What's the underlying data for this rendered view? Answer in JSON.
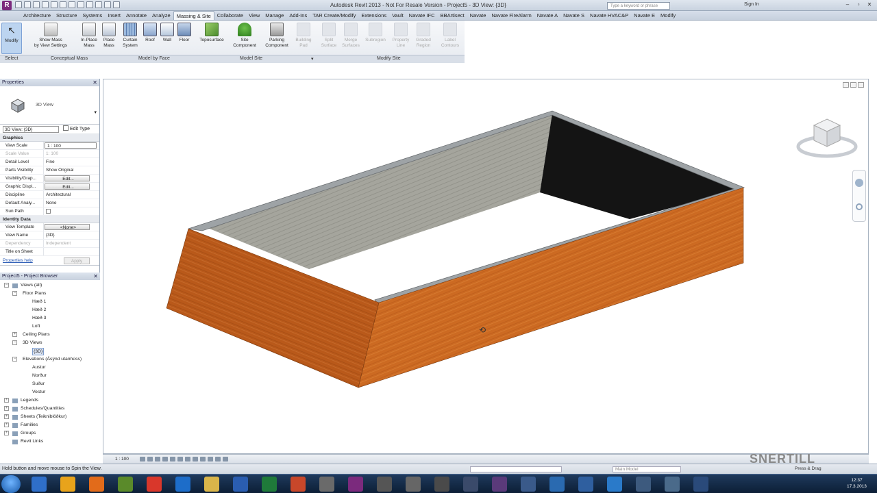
{
  "window": {
    "title": "Autodesk Revit 2013 - Not For Resale Version - Project5 - 3D View: {3D}",
    "search_placeholder": "Type a keyword or phrase",
    "sign_in": "Sign In"
  },
  "tabs": [
    "Architecture",
    "Structure",
    "Systems",
    "Insert",
    "Annotate",
    "Analyze",
    "Massing & Site",
    "Collaborate",
    "View",
    "Manage",
    "Add-Ins",
    "TAR Create/Modify",
    "Extensions",
    "Vault",
    "Navate IFC",
    "BBArtisect",
    "Navate",
    "Navate FireAlarm",
    "Navate A",
    "Navate S",
    "Navate HVAC&P",
    "Navate E",
    "Modify"
  ],
  "active_tab": "Massing & Site",
  "ribbon": {
    "modify": "Modify",
    "show_mass": [
      "Show Mass",
      "by View Settings"
    ],
    "in_place_mass": [
      "In-Place",
      "Mass"
    ],
    "place_mass": [
      "Place",
      "Mass"
    ],
    "curtain_system": [
      "Curtain",
      "System"
    ],
    "roof": "Roof",
    "wall": "Wall",
    "floor": "Floor",
    "toposurface": "Toposurface",
    "site_component": [
      "Site",
      "Component"
    ],
    "parking_component": [
      "Parking",
      "Component"
    ],
    "building_pad": [
      "Building",
      "Pad"
    ],
    "split_surface": [
      "Split",
      "Surface"
    ],
    "merge_surfaces": [
      "Merge",
      "Surfaces"
    ],
    "subregion": "Subregion",
    "property_line": [
      "Property",
      "Line"
    ],
    "graded_region": [
      "Graded",
      "Region"
    ],
    "label_contours": [
      "Label",
      "Contours"
    ],
    "panels": {
      "select": "Select",
      "conceptual_mass": "Conceptual Mass",
      "model_by_face": "Model by Face",
      "model_site": "Model Site",
      "modify_site": "Modify Site"
    }
  },
  "properties": {
    "title": "Properties",
    "type_name": "3D View",
    "instance_selector": "3D View: {3D}",
    "edit_type": "Edit Type",
    "graphics_section": "Graphics",
    "identity_section": "Identity Data",
    "rows": [
      {
        "k": "View Scale",
        "v": "1 : 100"
      },
      {
        "k": "Scale Value",
        "v": "1:  100"
      },
      {
        "k": "Detail Level",
        "v": "Fine"
      },
      {
        "k": "Parts Visibility",
        "v": "Show Original"
      },
      {
        "k": "Visibility/Grap...",
        "v": "Edit..."
      },
      {
        "k": "Graphic Displ...",
        "v": "Edit..."
      },
      {
        "k": "Discipline",
        "v": "Architectural"
      },
      {
        "k": "Default Analy...",
        "v": "None"
      },
      {
        "k": "Sun Path",
        "v": ""
      }
    ],
    "identity_rows": [
      {
        "k": "View Template",
        "v": "<None>"
      },
      {
        "k": "View Name",
        "v": "{3D}"
      },
      {
        "k": "Dependency",
        "v": "Independent"
      },
      {
        "k": "Title on Sheet",
        "v": ""
      }
    ],
    "help": "Properties help",
    "apply": "Apply"
  },
  "browser": {
    "title": "Project5 - Project Browser",
    "nodes": {
      "views": "Views (all)",
      "floor_plans": "Floor Plans",
      "h1": "Hæð 1",
      "h2": "Hæð 2",
      "h3": "Hæð 3",
      "loft": "Loft",
      "ceiling": "Ceiling Plans",
      "views3d": "3D Views",
      "v3d": "{3D}",
      "elev": "Elevations (Ásýnd utanhúss)",
      "austur": "Austur",
      "nordur": "Norður",
      "sudur": "Suður",
      "vestur": "Vestur",
      "legends": "Legends",
      "schedules": "Schedules/Quantities",
      "sheets": "Sheets (Teikniblöðkur)",
      "families": "Families",
      "groups": "Groups",
      "links": "Revit Links"
    }
  },
  "viewbar": {
    "scale": "1 : 100"
  },
  "status": {
    "text": "Hold button and move mouse to Spin the View.",
    "model": "Main Model",
    "press_drag": "Press & Drag"
  },
  "watermark": "SNERTILL",
  "clock": {
    "time": "12:37",
    "date": "17.3.2013"
  },
  "colors": {
    "wall_exterior": "#c8621e",
    "wall_interior": "#9a9a93",
    "ribbon_bg": "#eef1f5"
  }
}
